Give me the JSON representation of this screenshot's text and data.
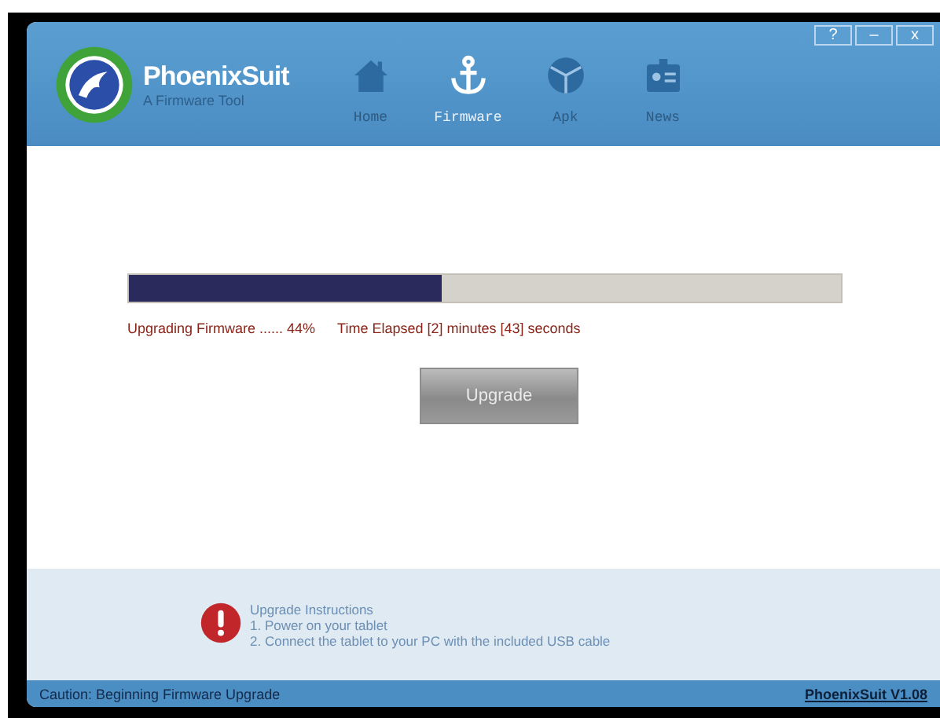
{
  "window": {
    "app_name": "PhoenixSuit",
    "tagline": "A Firmware Tool",
    "controls": [
      "?",
      "–",
      "x"
    ]
  },
  "tabs": [
    {
      "label": "Home",
      "selected": false
    },
    {
      "label": "Firmware",
      "selected": true
    },
    {
      "label": "Apk",
      "selected": false
    },
    {
      "label": "News",
      "selected": false
    }
  ],
  "progress": {
    "level": 0.44,
    "status": "Upgrading Firmware ...... 44%",
    "elapsed": "Time Elapsed [2] minutes [43] seconds"
  },
  "upgrade_button": {
    "label": "Upgrade",
    "disabled": true
  },
  "instructions": {
    "title": "Upgrade Instructions",
    "steps": [
      "1. Power on your tablet",
      "2. Connect the tablet to your PC with the included USB cable"
    ]
  },
  "status_bar": {
    "message": "Caution: Beginning Firmware Upgrade",
    "version": "PhoenixSuit V1.08"
  }
}
